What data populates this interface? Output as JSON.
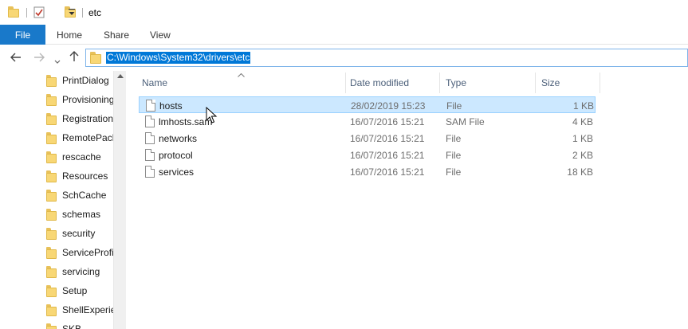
{
  "window": {
    "title": "etc"
  },
  "ribbon": {
    "tabs": [
      {
        "label": "File"
      },
      {
        "label": "Home"
      },
      {
        "label": "Share"
      },
      {
        "label": "View"
      }
    ]
  },
  "address": {
    "path": "C:\\Windows\\System32\\drivers\\etc"
  },
  "sidebar": {
    "items": [
      {
        "label": "PrintDialog"
      },
      {
        "label": "Provisioning"
      },
      {
        "label": "Registration"
      },
      {
        "label": "RemotePackages"
      },
      {
        "label": "rescache"
      },
      {
        "label": "Resources"
      },
      {
        "label": "SchCache"
      },
      {
        "label": "schemas"
      },
      {
        "label": "security"
      },
      {
        "label": "ServiceProfiles"
      },
      {
        "label": "servicing"
      },
      {
        "label": "Setup"
      },
      {
        "label": "ShellExperiences"
      },
      {
        "label": "SKB"
      }
    ]
  },
  "columns": {
    "name": "Name",
    "date": "Date modified",
    "type": "Type",
    "size": "Size"
  },
  "files": [
    {
      "name": "hosts",
      "date": "28/02/2019 15:23",
      "type": "File",
      "size": "1 KB",
      "selected": true
    },
    {
      "name": "lmhosts.sam",
      "date": "16/07/2016 15:21",
      "type": "SAM File",
      "size": "4 KB",
      "selected": false
    },
    {
      "name": "networks",
      "date": "16/07/2016 15:21",
      "type": "File",
      "size": "1 KB",
      "selected": false
    },
    {
      "name": "protocol",
      "date": "16/07/2016 15:21",
      "type": "File",
      "size": "2 KB",
      "selected": false
    },
    {
      "name": "services",
      "date": "16/07/2016 15:21",
      "type": "File",
      "size": "18 KB",
      "selected": false
    }
  ],
  "colors": {
    "file_tab": "#1979ca",
    "selection": "#cce8ff",
    "address_selection": "#0078d7",
    "folder": "#f8d775"
  },
  "icons": [
    "folder-icon",
    "properties-check-icon",
    "customize-dropdown-icon",
    "back-arrow-icon",
    "forward-arrow-icon",
    "recent-chevron-icon",
    "up-arrow-icon",
    "file-icon"
  ]
}
